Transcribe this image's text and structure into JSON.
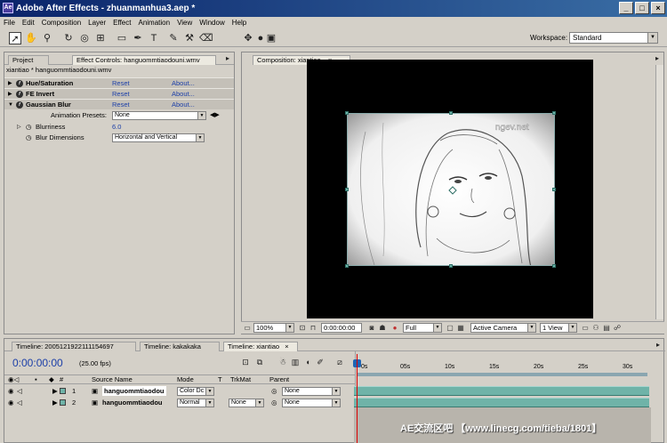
{
  "window": {
    "title": "Adobe After Effects - zhuanmanhua3.aep *",
    "app_icon": "Ae"
  },
  "menu": [
    "File",
    "Edit",
    "Composition",
    "Layer",
    "Effect",
    "Animation",
    "View",
    "Window",
    "Help"
  ],
  "workspace": {
    "label": "Workspace:",
    "value": "Standard"
  },
  "effect_panel": {
    "tab_project": "Project",
    "tab_effect_controls": "Effect Controls: hanguommtiaodouni.wmv",
    "subtitle": "xiantiao * hanguommtiaodouni.wmv",
    "reset_label": "Reset",
    "about_label": "About...",
    "effects": [
      {
        "name": "Hue/Saturation"
      },
      {
        "name": "FE Invert"
      },
      {
        "name": "Gaussian Blur"
      }
    ],
    "presets_label": "Animation Presets:",
    "presets_value": "None",
    "blurriness_label": "Blurriness",
    "blurriness_value": "6.0",
    "blur_dims_label": "Blur Dimensions",
    "blur_dims_value": "Horizontal and Vertical"
  },
  "comp_panel": {
    "tab": "Composition: xiantiao",
    "footage_watermark": "ngev.net",
    "zoom": "100%",
    "timecode": "0:00:00:00",
    "resolution": "Full",
    "camera": "Active Camera",
    "view": "1 View"
  },
  "timeline": {
    "tabs": [
      "Timeline: 2005121922111154697",
      "Timeline: kakakaka",
      "Timeline: xiantiao"
    ],
    "timecode": "0:00:00:00",
    "fps": "(25.00 fps)",
    "columns": {
      "source": "Source Name",
      "mode": "Mode",
      "t": "T",
      "trkmat": "TrkMat",
      "parent": "Parent"
    },
    "ticks": [
      "0s",
      "05s",
      "10s",
      "15s",
      "20s",
      "25s",
      "30s"
    ],
    "layers": [
      {
        "num": "1",
        "name": "hanguommtiaodou",
        "mode": "Color Dc",
        "trkmat": "",
        "parent": "None"
      },
      {
        "num": "2",
        "name": "hanguommtiaodou",
        "mode": "Normal",
        "trkmat": "None",
        "parent": "None"
      }
    ]
  },
  "overlay_watermark": "AE交流区吧 【www.linecg.com/tieba/1801】"
}
